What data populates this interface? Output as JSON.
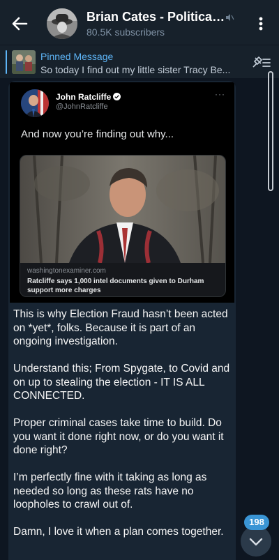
{
  "header": {
    "title": "Brian Cates - Political...",
    "subtitle": "80.5K subscribers"
  },
  "pinned": {
    "label": "Pinned Message",
    "text": "So today I find out my little sister Tracy Be..."
  },
  "tweet": {
    "author_name": "John Ratcliffe",
    "author_handle": "@JohnRatcliffe",
    "more": "···",
    "text": "And now you’re finding out why...",
    "card_domain": "washingtonexaminer.com",
    "card_title": "Ratcliffe says 1,000 intel documents given to Durham support more charges"
  },
  "message": {
    "paragraphs": [
      "This is why Election Fraud hasn’t been acted on *yet*, folks. Because it is part of an ongoing investigation.",
      "Understand this; From Spygate, to Covid and on up to stealing the election - IT IS ALL CONNECTED.",
      "Proper criminal cases take time to build. Do you want it done right now, or do you want it done right?",
      "I’m perfectly fine with it taking as long as needed so long as these rats have no loopholes to crawl out of.",
      "Damn, I love it when a plan comes together."
    ]
  },
  "unread_count": "198",
  "icons": {
    "back": "arrow-left-icon",
    "mute": "muted-speaker-icon",
    "menu": "more-vertical-icon",
    "pinned_list": "pin-list-icon",
    "verified": "verified-check-icon",
    "scroll_down": "chevron-down-icon"
  },
  "colors": {
    "background": "#0e1621",
    "header": "#17212b",
    "bubble": "#182533",
    "accent": "#5eb5f7",
    "badge": "#3a95d5"
  }
}
